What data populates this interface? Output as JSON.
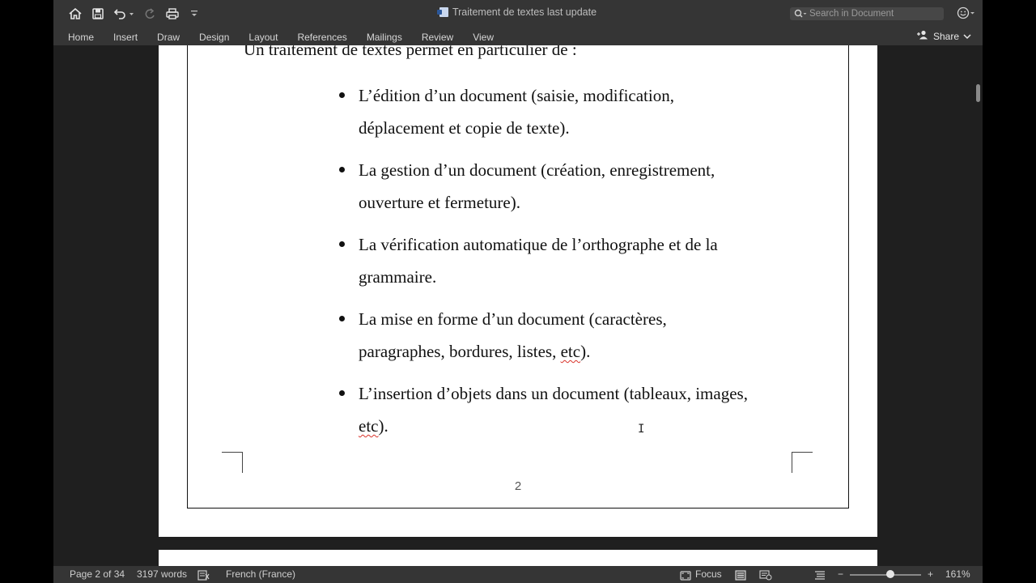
{
  "window": {
    "title": "Traitement de textes last update",
    "search_placeholder": "Search in Document"
  },
  "ribbon": {
    "tabs": [
      "Home",
      "Insert",
      "Draw",
      "Design",
      "Layout",
      "References",
      "Mailings",
      "Review",
      "View"
    ],
    "share_label": "Share"
  },
  "document": {
    "intro": "Un traitement de textes permet en particulier de :",
    "bullets": [
      {
        "lines": [
          "L’édition d’un document (saisie, modification,",
          "déplacement et copie de texte)."
        ]
      },
      {
        "lines": [
          "La gestion d’un document (création, enregistrement,",
          "ouverture et fermeture)."
        ]
      },
      {
        "lines": [
          "La vérification automatique de l’orthographe et de la",
          "grammaire."
        ]
      },
      {
        "lines_a": [
          "La mise en forme d’un document (caractères,",
          "paragraphes, bordures, listes, "
        ],
        "squiggle": "etc",
        "tail": ")."
      },
      {
        "lines_a": [
          "L’insertion d’objets dans un document (tableaux, images,",
          ""
        ],
        "squiggle": "etc",
        "tail": ")."
      }
    ],
    "page_number": "2"
  },
  "status": {
    "page": "Page 2 of 34",
    "words": "3197 words",
    "language": "French (France)",
    "focus": "Focus",
    "zoom": "161%",
    "minus": "−",
    "plus": "+"
  }
}
